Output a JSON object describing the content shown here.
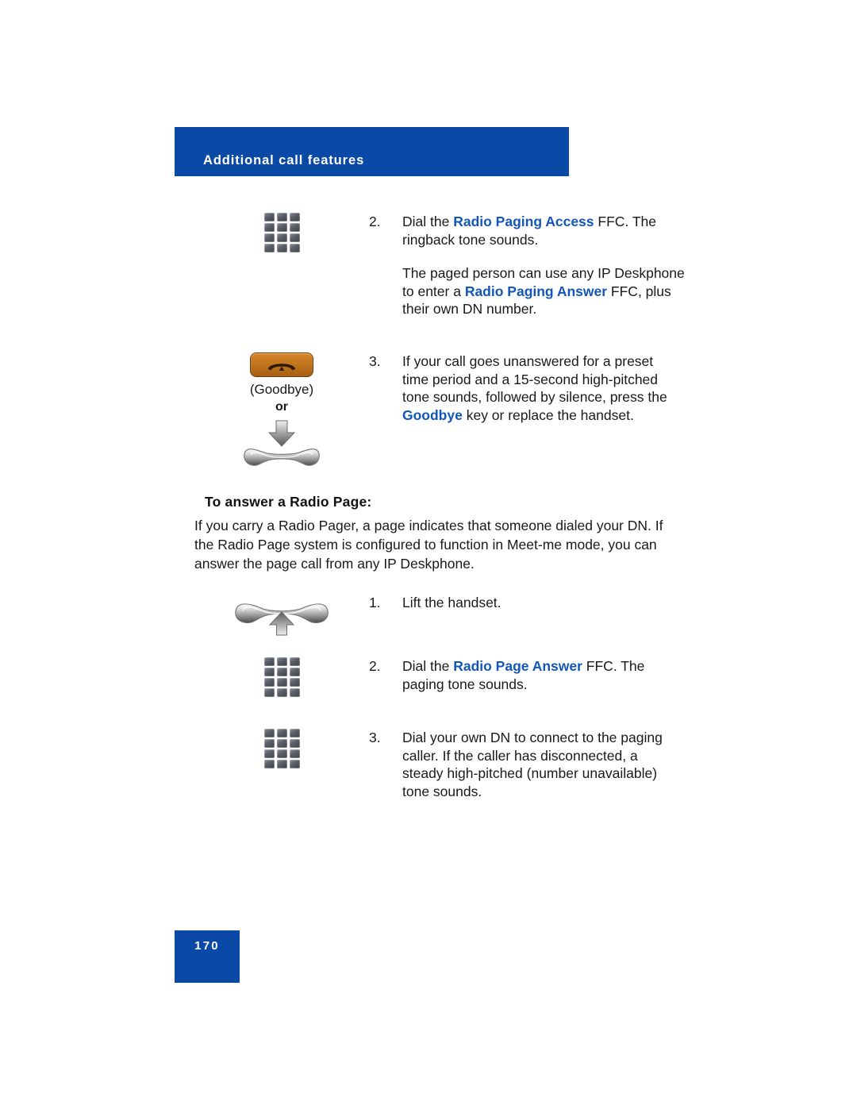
{
  "header": {
    "title": "Additional call features",
    "banner_color": "#0b49a6"
  },
  "footer": {
    "page_number": "170",
    "badge_color": "#0b49a6"
  },
  "accent": {
    "highlight_text_color": "#1257b8",
    "key_color": "#c2761e"
  },
  "steps_top": [
    {
      "number": "2.",
      "icon": "keypad-icon",
      "paragraphs": [
        {
          "parts": [
            {
              "text": "Dial the ",
              "style": "normal"
            },
            {
              "text": "Radio Paging Access",
              "style": "highlight"
            },
            {
              "text": " FFC. The ringback tone sounds.",
              "style": "normal"
            }
          ]
        },
        {
          "parts": [
            {
              "text": "The paged person can use any IP Deskphone to enter a ",
              "style": "normal"
            },
            {
              "text": "Radio Paging Answer",
              "style": "highlight"
            },
            {
              "text": " FFC, plus their own DN number.",
              "style": "normal"
            }
          ]
        }
      ]
    },
    {
      "number": "3.",
      "icon": "goodbye-key-icon",
      "icon_caption": "(Goodbye)",
      "icon_or_label": "or",
      "icon_secondary": "replace-handset-icon",
      "paragraphs": [
        {
          "parts": [
            {
              "text": "If your call goes unanswered for a preset time period and a 15-second high-pitched tone sounds, followed by silence, press the ",
              "style": "normal"
            },
            {
              "text": "Goodbye",
              "style": "highlight"
            },
            {
              "text": " key or replace the handset.",
              "style": "normal"
            }
          ]
        }
      ]
    }
  ],
  "section": {
    "heading": "To answer a Radio Page:",
    "paragraph": "If you carry a Radio Pager, a page indicates that someone dialed your DN. If the Radio Page system is configured to function in Meet-me mode, you can answer the page call from any IP Deskphone."
  },
  "steps_bottom": [
    {
      "number": "1.",
      "icon": "lift-handset-icon",
      "paragraphs": [
        {
          "parts": [
            {
              "text": "Lift the handset.",
              "style": "normal"
            }
          ]
        }
      ]
    },
    {
      "number": "2.",
      "icon": "keypad-icon",
      "paragraphs": [
        {
          "parts": [
            {
              "text": "Dial the ",
              "style": "normal"
            },
            {
              "text": "Radio Page Answer",
              "style": "highlight"
            },
            {
              "text": " FFC. The paging tone sounds.",
              "style": "normal"
            }
          ]
        }
      ]
    },
    {
      "number": "3.",
      "icon": "keypad-icon",
      "paragraphs": [
        {
          "parts": [
            {
              "text": "Dial your own DN to connect to the paging caller. If the caller has disconnected, a steady high-pitched (number unavailable) tone sounds.",
              "style": "normal"
            }
          ]
        }
      ]
    }
  ]
}
